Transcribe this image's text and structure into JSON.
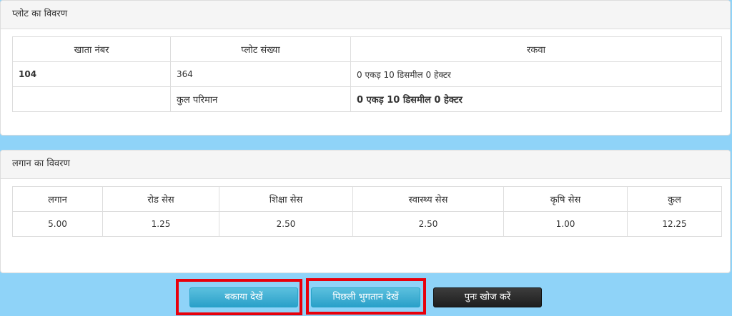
{
  "plot_panel": {
    "title": "प्लोट का विवरण",
    "headers": [
      "खाता नंबर",
      "प्लोट संख्या",
      "रकवा"
    ],
    "row": {
      "khata": "104",
      "plot": "364",
      "rakwa": "0 एकड़ 10 डिसमील 0 हेक्टर"
    },
    "total": {
      "label": "कुल परिमान",
      "value": "0 एकड़ 10 डिसमील 0 हेक्टर"
    }
  },
  "lagan_panel": {
    "title": "लगान का विवरण",
    "headers": [
      "लगान",
      "रोड सेस",
      "शिक्षा सेस",
      "स्वास्थ्य सेस",
      "कृषि सेस",
      "कुल"
    ],
    "values": [
      "5.00",
      "1.25",
      "2.50",
      "2.50",
      "1.00",
      "12.25"
    ]
  },
  "actions": {
    "view_dues": "बकाया देखें",
    "view_previous_payments": "पिछली भुगतान देखें",
    "search_again": "पुनः खोज करें"
  },
  "colors": {
    "page_background": "#8fd3f8",
    "highlight": "#e8000b",
    "button_info": "#39b3d7",
    "button_dark": "#2b2b2b"
  }
}
